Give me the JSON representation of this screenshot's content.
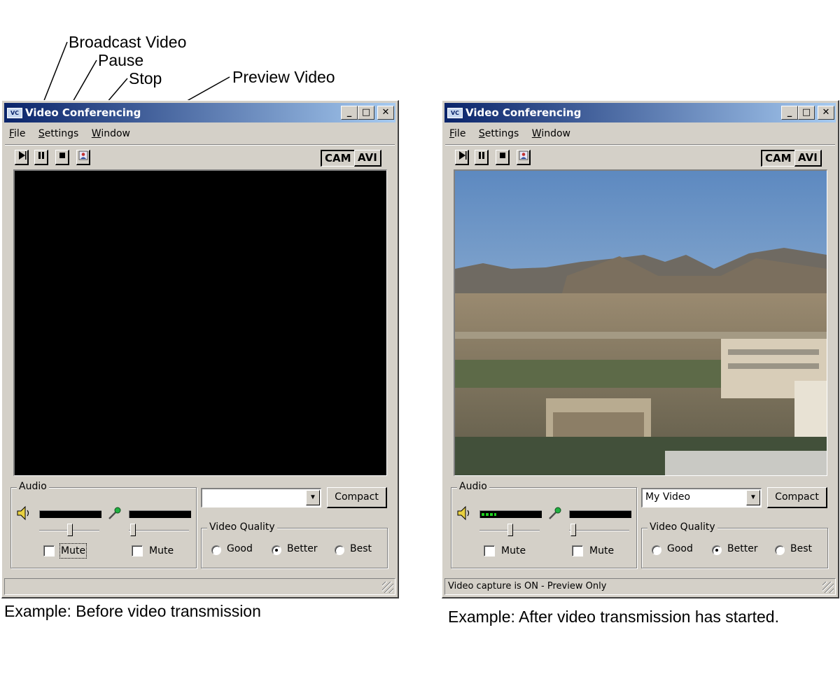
{
  "callouts": {
    "broadcast": "Broadcast Video",
    "pause": "Pause",
    "stop": "Stop",
    "preview": "Preview Video"
  },
  "colors": {
    "title_gradient_start": "#0a246a",
    "title_gradient_end": "#a6caf0",
    "window_face": "#d4d0c8",
    "meter_active": "#1fd11f"
  },
  "windows": [
    {
      "caption": "Example: Before video transmission",
      "title": "Video Conferencing",
      "title_buttons": {
        "minimize": "_",
        "maximize": "□",
        "close": "✕"
      },
      "menu": [
        "File",
        "Settings",
        "Window"
      ],
      "mode_buttons": [
        "CAM",
        "AVI"
      ],
      "video_state": "black",
      "audio": {
        "label": "Audio",
        "speaker_level": 0,
        "mic_level": 0,
        "speaker_mute": "Mute",
        "mic_mute": "Mute"
      },
      "channel_value": "",
      "compact_label": "Compact",
      "quality": {
        "label": "Video Quality",
        "options": [
          "Good",
          "Better",
          "Best"
        ],
        "selected": "Better"
      },
      "status": ""
    },
    {
      "caption": "Example: After video transmission has started.",
      "title": "Video Conferencing",
      "title_buttons": {
        "minimize": "_",
        "maximize": "□",
        "close": "✕"
      },
      "menu": [
        "File",
        "Settings",
        "Window"
      ],
      "mode_buttons": [
        "CAM",
        "AVI"
      ],
      "video_state": "preview",
      "audio": {
        "label": "Audio",
        "speaker_level": 0.25,
        "mic_level": 0,
        "speaker_mute": "Mute",
        "mic_mute": "Mute"
      },
      "channel_value": "My Video",
      "compact_label": "Compact",
      "quality": {
        "label": "Video Quality",
        "options": [
          "Good",
          "Better",
          "Best"
        ],
        "selected": "Better"
      },
      "status": "Video capture is ON - Preview Only"
    }
  ]
}
